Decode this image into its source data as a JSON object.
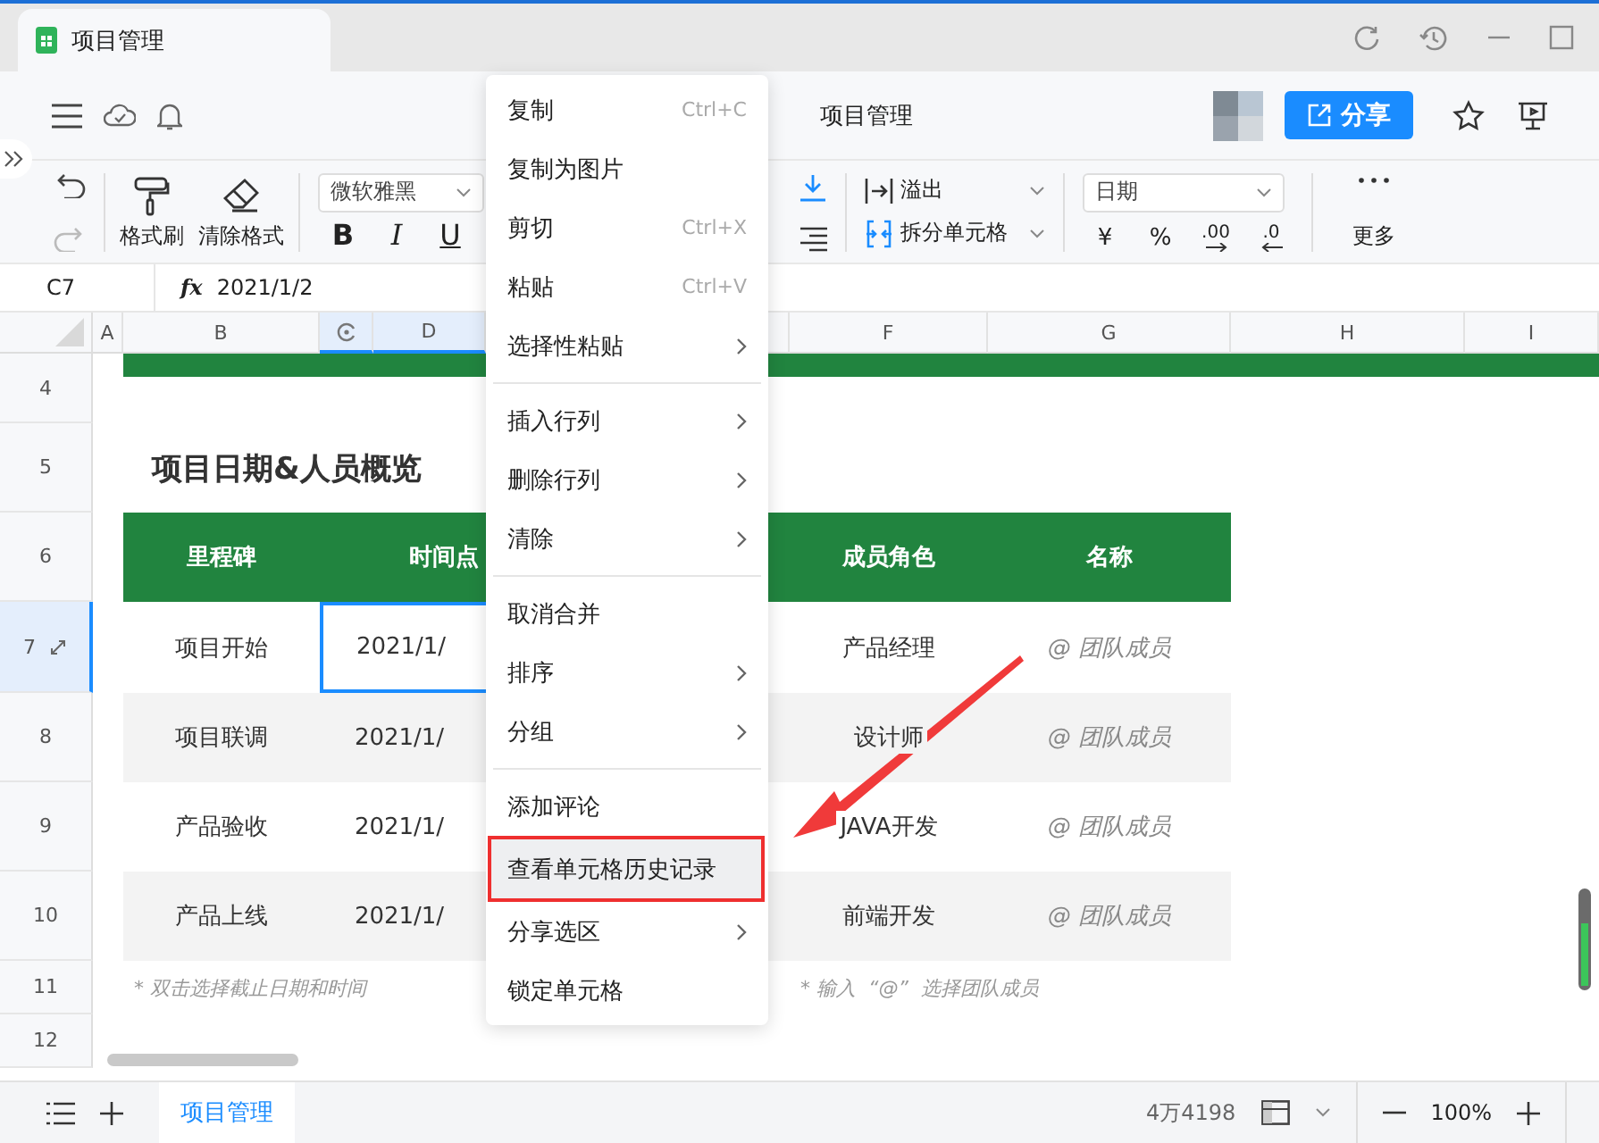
{
  "app_tab": {
    "title": "项目管理",
    "selected": true
  },
  "header": {
    "doc_title": "项目管理",
    "share_label": "分享"
  },
  "toolbar": {
    "format_painter": "格式刷",
    "clear_format": "清除格式",
    "font": "微软雅黑",
    "text_styles": [
      "B",
      "I",
      "U"
    ],
    "overflow": "溢出",
    "split_cells": "拆分单元格",
    "number_format": "日期",
    "currency": "¥",
    "percent": "%",
    "add_decimal": ".00",
    "remove_decimal": ".0",
    "more": "更多"
  },
  "formula_bar": {
    "cell": "C7",
    "fx": "fx",
    "value": "2021/1/2"
  },
  "columns": [
    {
      "kind": "letter",
      "label": "A",
      "selected": false
    },
    {
      "kind": "letter",
      "label": "B",
      "selected": false
    },
    {
      "kind": "icon",
      "selected": true
    },
    {
      "kind": "letter",
      "label": "D",
      "selected": true
    },
    {
      "kind": "letter",
      "label": "F",
      "selected": false
    },
    {
      "kind": "letter",
      "label": "G",
      "selected": false
    },
    {
      "kind": "letter",
      "label": "H",
      "selected": false
    },
    {
      "kind": "letter",
      "label": "I",
      "selected": false
    }
  ],
  "row_numbers": [
    {
      "label": "4",
      "selected": false
    },
    {
      "label": "5",
      "selected": false
    },
    {
      "label": "6",
      "selected": false
    },
    {
      "label": "7",
      "selected": true
    },
    {
      "label": "8",
      "selected": false
    },
    {
      "label": "9",
      "selected": false
    },
    {
      "label": "10",
      "selected": false
    },
    {
      "label": "11",
      "selected": false
    },
    {
      "label": "12",
      "selected": false
    }
  ],
  "sheet": {
    "title": "项目日期&人员概览",
    "headers": [
      "里程碑",
      "时间点",
      "成员角色",
      "名称"
    ],
    "rows": [
      {
        "milestone": "项目开始",
        "time": "2021/1/",
        "role": "产品经理",
        "name": "@ 团队成员",
        "selected": true
      },
      {
        "milestone": "项目联调",
        "time": "2021/1/",
        "role": "设计师",
        "name": "@ 团队成员",
        "selected": false
      },
      {
        "milestone": "产品验收",
        "time": "2021/1/",
        "role": "JAVA开发",
        "name": "@ 团队成员",
        "selected": false
      },
      {
        "milestone": "产品上线",
        "time": "2021/1/",
        "role": "前端开发",
        "name": "@ 团队成员",
        "selected": false
      }
    ],
    "notes": [
      "* 双击选择截止日期和时间",
      "* 输入  “@”  选择团队成员"
    ]
  },
  "context_menu": {
    "groups": [
      [
        {
          "label": "复制",
          "shortcut": "Ctrl+C",
          "submenu": false,
          "highlighted": false
        },
        {
          "label": "复制为图片",
          "submenu": false,
          "highlighted": false
        },
        {
          "label": "剪切",
          "shortcut": "Ctrl+X",
          "submenu": false,
          "highlighted": false
        },
        {
          "label": "粘贴",
          "shortcut": "Ctrl+V",
          "submenu": false,
          "highlighted": false
        },
        {
          "label": "选择性粘贴",
          "submenu": true,
          "highlighted": false
        }
      ],
      [
        {
          "label": "插入行列",
          "submenu": true,
          "highlighted": false
        },
        {
          "label": "删除行列",
          "submenu": true,
          "highlighted": false
        },
        {
          "label": "清除",
          "submenu": true,
          "highlighted": false
        }
      ],
      [
        {
          "label": "取消合并",
          "submenu": false,
          "highlighted": false
        },
        {
          "label": "排序",
          "submenu": true,
          "highlighted": false
        },
        {
          "label": "分组",
          "submenu": true,
          "highlighted": false
        }
      ],
      [
        {
          "label": "添加评论",
          "submenu": false,
          "highlighted": false
        },
        {
          "label": "查看单元格历史记录",
          "submenu": false,
          "highlighted": true
        },
        {
          "label": "分享选区",
          "submenu": true,
          "highlighted": false
        },
        {
          "label": "锁定单元格",
          "submenu": false,
          "highlighted": false
        }
      ]
    ]
  },
  "status_bar": {
    "sheet_tab": {
      "label": "项目管理",
      "selected": true
    },
    "count": "4万4198",
    "zoom": "100%"
  }
}
